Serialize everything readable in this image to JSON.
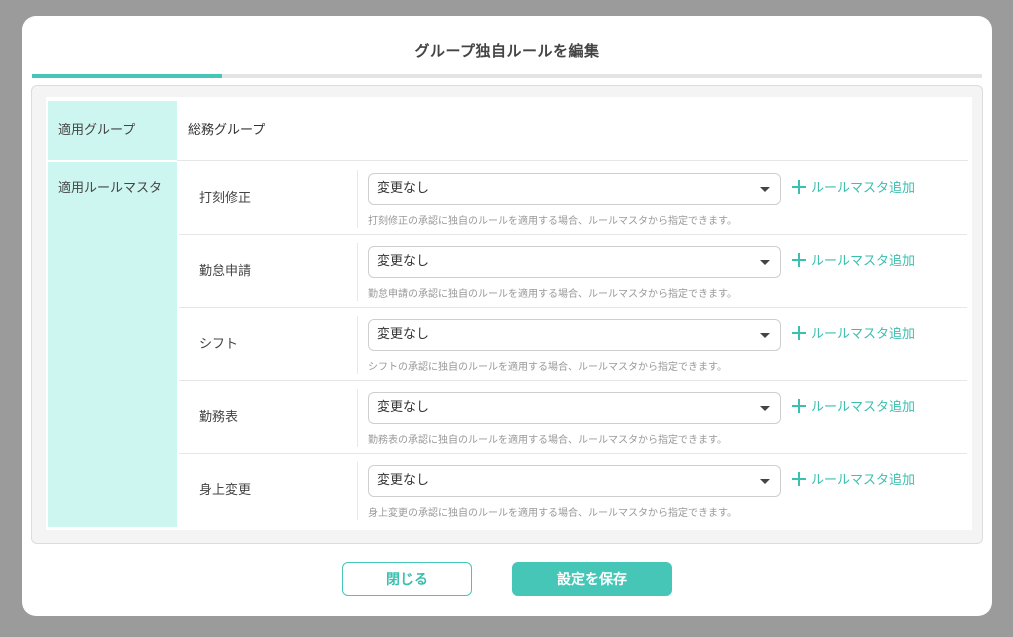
{
  "modal": {
    "title": "グループ独自ルールを編集"
  },
  "form": {
    "group_label": "適用グループ",
    "group_value": "総務グループ",
    "rule_label": "適用ルールマスタ",
    "add_label": "ルールマスタ追加",
    "rules": [
      {
        "name": "打刻修正",
        "value": "変更なし",
        "help": "打刻修正の承認に独自のルールを適用する場合、ルールマスタから指定できます。"
      },
      {
        "name": "勤怠申請",
        "value": "変更なし",
        "help": "勤怠申請の承認に独自のルールを適用する場合、ルールマスタから指定できます。"
      },
      {
        "name": "シフト",
        "value": "変更なし",
        "help": "シフトの承認に独自のルールを適用する場合、ルールマスタから指定できます。"
      },
      {
        "name": "勤務表",
        "value": "変更なし",
        "help": "勤務表の承認に独自のルールを適用する場合、ルールマスタから指定できます。"
      },
      {
        "name": "身上変更",
        "value": "変更なし",
        "help": "身上変更の承認に独自のルールを適用する場合、ルールマスタから指定できます。"
      }
    ]
  },
  "footer": {
    "close_label": "閉じる",
    "save_label": "設定を保存"
  },
  "colors": {
    "accent": "#45c6b7",
    "label_bg": "#cdf6f0"
  }
}
